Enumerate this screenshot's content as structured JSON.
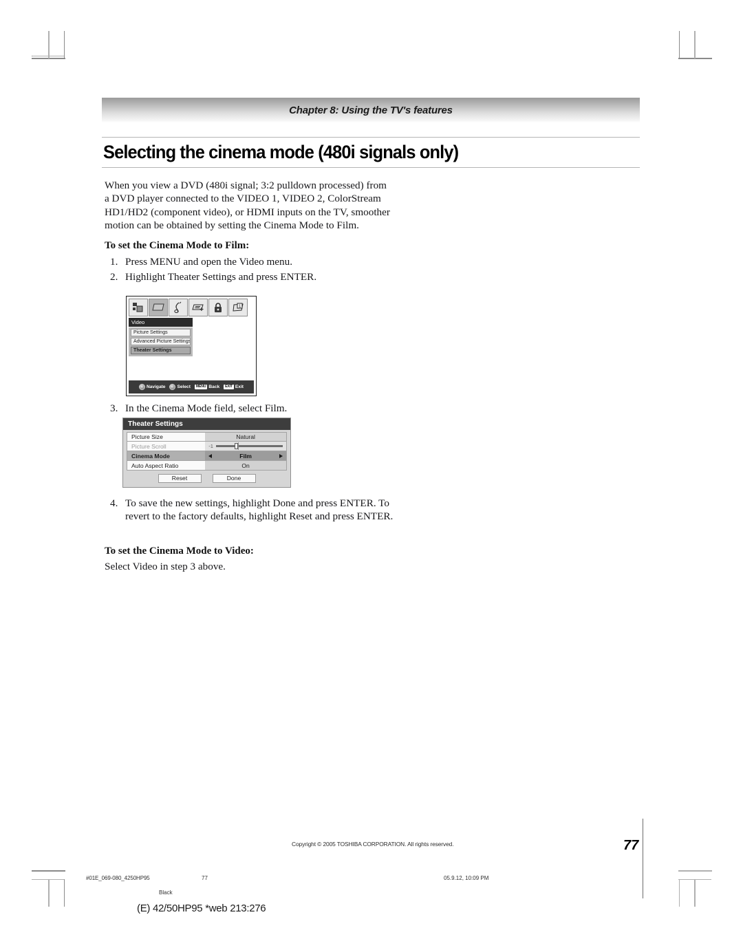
{
  "header": {
    "chapter": "Chapter 8: Using the TV's features"
  },
  "title": "Selecting the cinema mode (480i signals only)",
  "body": {
    "intro": "When you view a DVD (480i signal; 3:2 pulldown processed) from a DVD player connected to the VIDEO 1, VIDEO 2, ColorStream HD1/HD2 (component video), or HDMI inputs on the TV, smoother motion can be obtained by setting the Cinema Mode to Film.",
    "film_heading": "To set the Cinema Mode to Film:",
    "step1_num": "1.",
    "step1": "Press MENU and open the Video menu.",
    "step2_num": "2.",
    "step2": "Highlight Theater Settings and press ENTER.",
    "step3_num": "3.",
    "step3": "In the Cinema Mode field, select Film.",
    "step4_num": "4.",
    "step4": "To save the new settings, highlight Done and press ENTER. To revert to the factory defaults, highlight Reset and press ENTER.",
    "video_heading": "To set the Cinema Mode to Video:",
    "video_line": "Select Video in step 3 above."
  },
  "tv_menu": {
    "icons": [
      "antenna-icon",
      "picture-icon",
      "audio-note-icon",
      "captions-icon",
      "lock-icon",
      "setup-icon"
    ],
    "selected_icon_index": 1,
    "title": "Video",
    "items": [
      {
        "label": "Picture Settings",
        "highlighted": false
      },
      {
        "label": "Advanced Picture Settings",
        "highlighted": false
      },
      {
        "label": "Theater Settings",
        "highlighted": true
      }
    ],
    "nav": [
      {
        "key": "",
        "icon": "dpad-icon",
        "label": "Navigate"
      },
      {
        "key": "",
        "icon": "enter-icon",
        "label": "Select"
      },
      {
        "key": "MENU",
        "icon": "",
        "label": "Back"
      },
      {
        "key": "EXIT",
        "icon": "",
        "label": "Exit"
      }
    ]
  },
  "theater_settings": {
    "header": "Theater Settings",
    "rows": [
      {
        "label": "Picture Size",
        "value": "Natural",
        "state": "normal"
      },
      {
        "label": "Picture Scroll",
        "value": "-1",
        "state": "dim",
        "control": "slider",
        "thumb_pct": 28
      },
      {
        "label": "Cinema Mode",
        "value": "Film",
        "state": "active",
        "control": "spinner"
      },
      {
        "label": "Auto Aspect Ratio",
        "value": "On",
        "state": "normal"
      }
    ],
    "buttons": [
      {
        "label": "Reset"
      },
      {
        "label": "Done"
      }
    ]
  },
  "footer": {
    "copyright": "Copyright © 2005 TOSHIBA CORPORATION. All rights reserved.",
    "page_number": "77",
    "print_file": "#01E_069-080_4250HP95",
    "print_page": "77",
    "print_date": "05.9.12, 10:09 PM",
    "print_plate": "Black",
    "print_web": "(E) 42/50HP95 *web 213:276"
  }
}
